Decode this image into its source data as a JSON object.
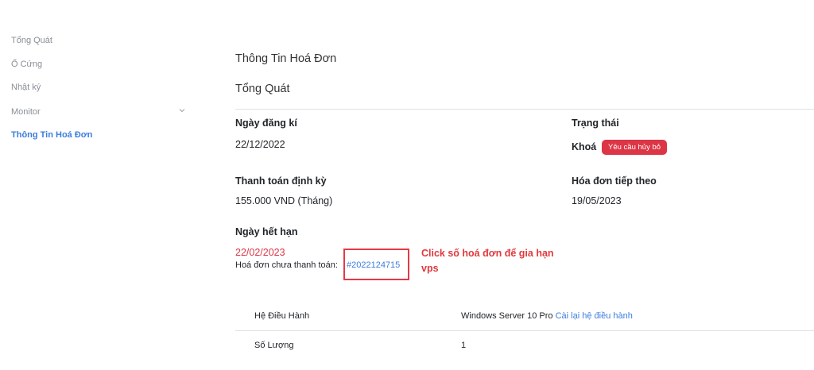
{
  "sidebar": {
    "items": [
      {
        "label": "Tổng Quát"
      },
      {
        "label": "Ổ Cứng"
      },
      {
        "label": "Nhật ký"
      },
      {
        "label": "Monitor"
      },
      {
        "label": "Thông Tin Hoá Đơn"
      }
    ],
    "active_index": 4
  },
  "main": {
    "title": "Thông Tin Hoá Đơn",
    "section_title": "Tổng Quát",
    "register_date": {
      "label": "Ngày đăng kí",
      "value": "22/12/2022"
    },
    "status": {
      "label": "Trạng thái",
      "value": "Khoá",
      "badge": "Yêu cầu hủy bỏ"
    },
    "recurring": {
      "label": "Thanh toán định kỳ",
      "value": "155.000 VND (Tháng)"
    },
    "next_invoice": {
      "label": "Hóa đơn tiếp theo",
      "value": "19/05/2023"
    },
    "expiry": {
      "label": "Ngày hết hạn",
      "value": "22/02/2023",
      "unpaid_label": "Hoá đơn chưa thanh toán:",
      "invoice_number": "#2022124715"
    },
    "annotation": "Click số hoá đơn để gia hạn vps",
    "table": [
      {
        "key": "Hệ Điều Hành",
        "value": "Windows Server 10 Pro",
        "link": "Cài lại hệ điều hành"
      },
      {
        "key": "Số Lượng",
        "value": "1"
      }
    ]
  },
  "colors": {
    "accent": "#3b7ddd",
    "danger": "#dc3545",
    "annotation": "#e0393e",
    "muted": "#8a8f98"
  }
}
